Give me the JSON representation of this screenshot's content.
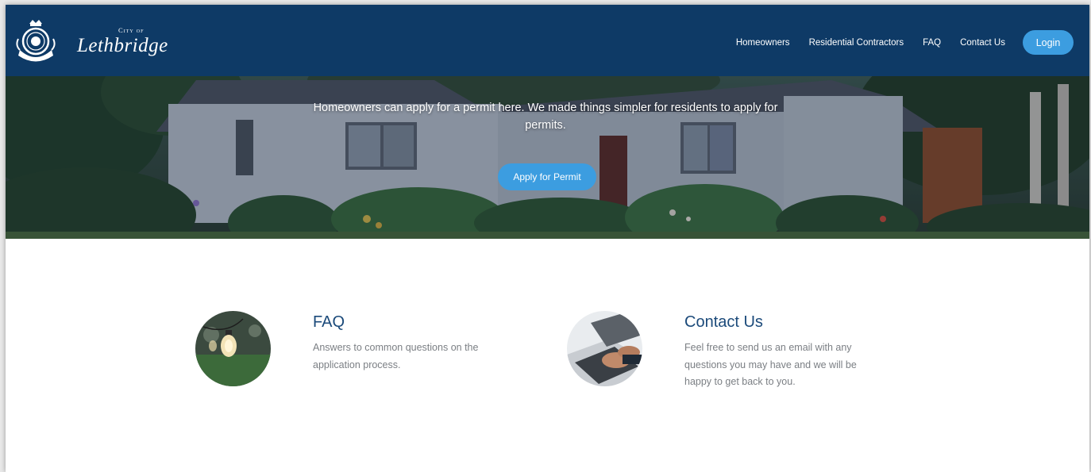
{
  "brand": {
    "city_of": "City of",
    "name": "Lethbridge",
    "seal_icon": "city-seal-icon"
  },
  "nav": {
    "items": [
      {
        "label": "Homeowners"
      },
      {
        "label": "Residential Contractors"
      },
      {
        "label": "FAQ"
      },
      {
        "label": "Contact Us"
      }
    ],
    "login_label": "Login"
  },
  "hero": {
    "text": "Homeowners can apply for a permit here. We made things simpler for residents to apply for permits.",
    "button_label": "Apply for Permit"
  },
  "cards": [
    {
      "title": "FAQ",
      "description": "Answers to common questions on the application process.",
      "image_icon": "lightbulb-photo"
    },
    {
      "title": "Contact Us",
      "description": "Feel free to send us an email with any questions you may have and we will be happy to get back to you.",
      "image_icon": "laptop-typing-photo"
    }
  ],
  "colors": {
    "header_bg": "#0e3a66",
    "accent": "#3c9de0",
    "card_title": "#1b4a7a",
    "body_text": "#7b7f84"
  }
}
